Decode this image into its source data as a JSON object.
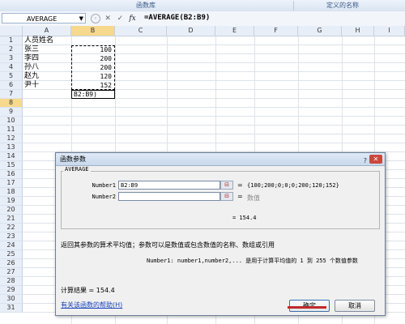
{
  "ribbon": {
    "groups": [
      "函数库",
      "定义的名称"
    ]
  },
  "formula_bar": {
    "name_box": "AVERAGE",
    "fx_label": "fx",
    "cancel_label": "✕",
    "enter_label": "✓",
    "formula": "=AVERAGE(B2:B9)"
  },
  "columns": [
    "A",
    "B",
    "C",
    "D",
    "E",
    "F",
    "G",
    "H",
    "I"
  ],
  "rows": [
    "1",
    "2",
    "3",
    "4",
    "5",
    "6",
    "7",
    "8",
    "9",
    "10",
    "11",
    "12",
    "13",
    "14",
    "15",
    "16",
    "17",
    "18",
    "19",
    "20",
    "21",
    "22",
    "23",
    "24",
    "25",
    "26",
    "27",
    "28",
    "29",
    "30",
    "31"
  ],
  "cells": {
    "a1": "人员姓名",
    "a2": "张三",
    "b2": "100",
    "a3": "李四",
    "b3": "200",
    "a7": "孙八",
    "b7": "200",
    "a8": "赵九",
    "b8": "120",
    "a9": "尹十",
    "b9": "152",
    "b10": "B2:B9)"
  },
  "dialog": {
    "title": "函数参数",
    "help_glyph": "?",
    "close_glyph": "✕",
    "function_name": "AVERAGE",
    "arg1_label": "Number1",
    "arg1_value": "B2:B9",
    "arg1_result": "{100;200;0;0;0;200;120;152}",
    "arg2_label": "Number2",
    "arg2_value": "",
    "arg2_result": "数值",
    "equals": "=",
    "result_line": "= 154.4",
    "description": "返回其参数的算术平均值；参数可以是数值或包含数值的名称、数组或引用",
    "param_desc": "Number1:  number1,number2,... 是用于计算平均值的 1 到 255 个数值参数",
    "calc_result": "计算结果 = 154.4",
    "help_link": "有关该函数的帮助(H)",
    "ok_label": "确定",
    "cancel_label": "取消"
  },
  "colors": {
    "accent": "#3a6fb0",
    "close": "#c9483c",
    "link": "#1a45b8"
  }
}
